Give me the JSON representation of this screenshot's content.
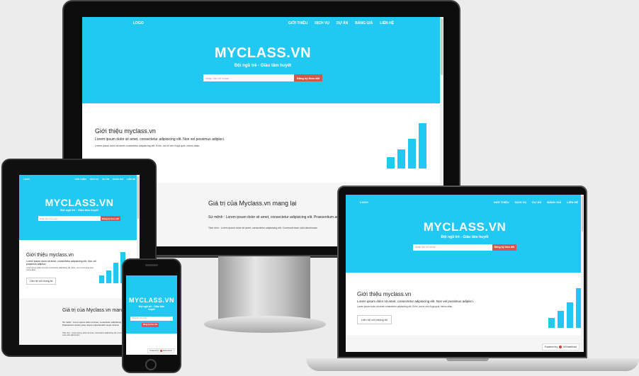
{
  "site": {
    "logo": "LOGO",
    "nav": [
      "GIỚI THIỆU",
      "DỊCH VỤ",
      "DỰ ÁN",
      "BẢNG GIÁ",
      "LIÊN HỆ"
    ],
    "brand": "MYCLASS.VN",
    "tagline": "Đội ngũ trẻ - Giàu tâm huyết",
    "email_placeholder": "Nhập địa chỉ email",
    "signup_button": "Đăng ký theo dõi",
    "about_title": "Giới thiệu myclass.vn",
    "about_lead": "Lorem ipsum dolor sit amet, consectetur adipisicing elit. Non vel possimus adipisci.",
    "about_body": "Lorem ipsum dolor sit amet consectetur adipisicing elit. Enim, aut et vero fuga quis, minus alias.",
    "contact_button": "Liên hệ với chúng tôi",
    "value_title": "Giá trị của Myclass.vn mang lại",
    "mission_lead": "Sứ mệnh : Lorem ipsum dolor sit amet, consectetur adipisicing elit. Praesentium autem esse neque reprehenderit sequi minima.",
    "vision_body": "Tầm nhìn : Lorem ipsum dolor sit amet, consectetur adipisicing elit. Commodi esse odio laboriosam.",
    "bars": [
      0.25,
      0.42,
      0.65,
      1.0
    ],
    "accent": "#21c8f1",
    "button_color": "#d9534f"
  },
  "widget": {
    "powered_by": "Powered by",
    "brand": "000webhost"
  }
}
